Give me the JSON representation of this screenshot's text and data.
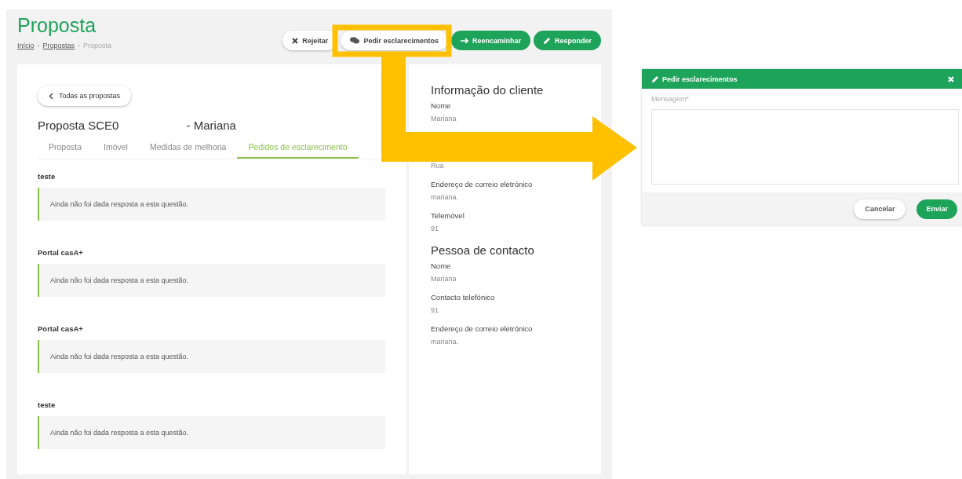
{
  "page": {
    "title": "Proposta",
    "separator": "›",
    "breadcrumb": [
      {
        "label": "Início",
        "link": true
      },
      {
        "label": "Propostas",
        "link": true
      },
      {
        "label": "Proposta",
        "link": false
      }
    ]
  },
  "actions": [
    {
      "label": "Rejeitar",
      "kind": "reject"
    },
    {
      "label": "Pedir esclarecimentos",
      "kind": "ask"
    },
    {
      "label": "Reencaminhar",
      "kind": "forward"
    },
    {
      "label": "Responder",
      "kind": "reply"
    }
  ],
  "back_button": "Todas as propostas",
  "proposal": {
    "code": "Proposta SCE0",
    "client": "- Mariana"
  },
  "tabs": [
    {
      "label": "Proposta",
      "selected": false
    },
    {
      "label": "Imóvel",
      "selected": false
    },
    {
      "label": "Medidas de melhoria",
      "selected": false
    },
    {
      "label": "Pedidos de esclarecimento",
      "selected": true
    }
  ],
  "requests": [
    {
      "question": "teste",
      "answer": "Ainda não foi dada resposta a esta questão."
    },
    {
      "question": "Portal casA+",
      "answer": "Ainda não foi dada resposta a esta questão."
    },
    {
      "question": "Portal casA+",
      "answer": "Ainda não foi dada resposta a esta questão."
    },
    {
      "question": "teste",
      "answer": "Ainda não foi dada resposta a esta questão."
    }
  ],
  "client_info": {
    "title": "Informação do cliente",
    "fields": [
      {
        "label": "Nome",
        "value": "Mariana"
      },
      {
        "value": "Rua"
      },
      {
        "label": "Endereço de correio eletrónico",
        "value": "mariana."
      },
      {
        "label": "Telemóvel",
        "value": "91"
      }
    ]
  },
  "contact": {
    "title": "Pessoa de contacto",
    "fields": [
      {
        "label": "Nome",
        "value": "Mariana"
      },
      {
        "label": "Contacto telefónico",
        "value": "91"
      },
      {
        "label": "Endereço de correio eletrónico",
        "value": "mariana."
      }
    ]
  },
  "dialog": {
    "title": "Pedir esclarecimentos",
    "field_label": "Mensagem*",
    "buttons": [
      {
        "label": "Cancelar",
        "kind": "secondary"
      },
      {
        "label": "Enviar",
        "kind": "primary"
      }
    ]
  }
}
